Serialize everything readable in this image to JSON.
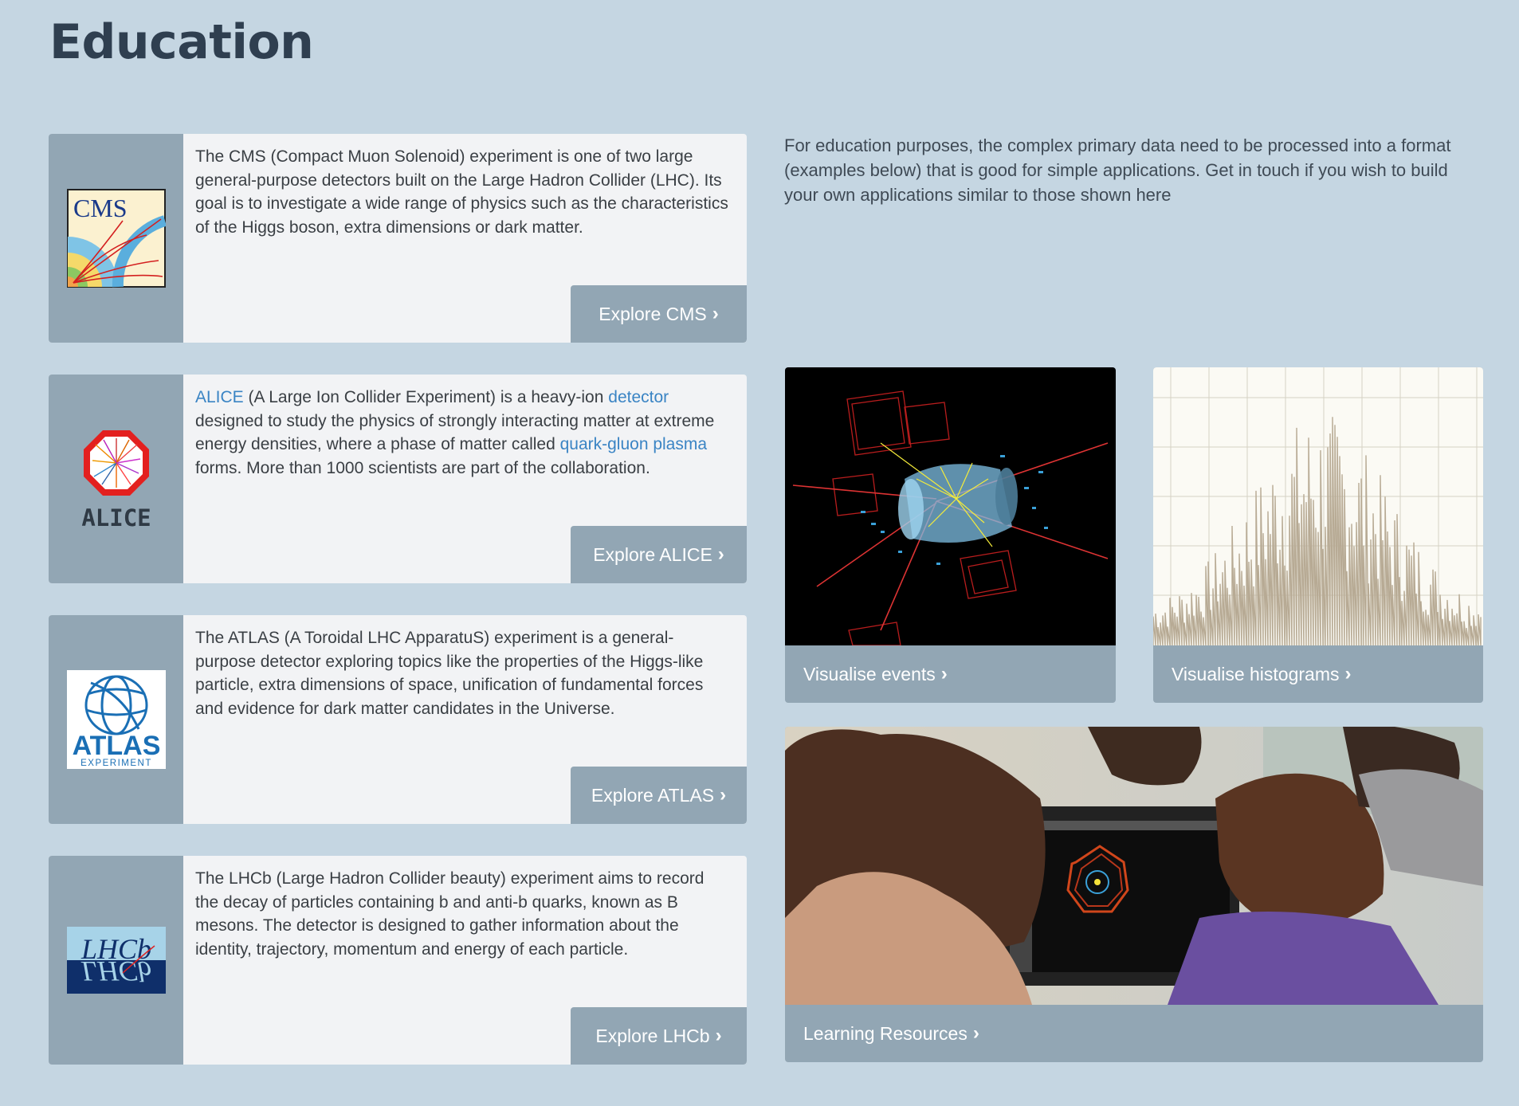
{
  "page": {
    "title": "Education"
  },
  "intro": "For education purposes, the complex primary data need to be processed into a format (examples below) that is good for simple applications. Get in touch if you wish to build your own applications similar to those shown here",
  "experiments": [
    {
      "id": "cms",
      "logo_text": "CMS",
      "description": "The CMS (Compact Muon Solenoid) experiment is one of two large general-purpose detectors built on the Large Hadron Collider (LHC). Its goal is to investigate a wide range of physics such as the characteristics of the Higgs boson, extra dimensions or dark matter.",
      "button": "Explore CMS"
    },
    {
      "id": "alice",
      "logo_text": "ALICE",
      "desc_parts": {
        "link1": "ALICE",
        "text1": " (A Large Ion Collider Experiment) is a heavy-ion ",
        "link2": "detector",
        "text2": " designed to study the physics of strongly interacting matter at extreme energy densities, where a phase of matter called ",
        "link3": "quark-gluon plasma",
        "text3": " forms. More than 1000 scientists are part of the collaboration."
      },
      "button": "Explore ALICE"
    },
    {
      "id": "atlas",
      "logo_text": "ATLAS",
      "logo_subtext": "EXPERIMENT",
      "description": "The ATLAS (A Toroidal LHC ApparatuS) experiment is a general-purpose detector exploring topics like the properties of the Higgs-like particle, extra dimensions of space, unification of fundamental forces and evidence for dark matter candidates in the Universe.",
      "button": "Explore ATLAS"
    },
    {
      "id": "lhcb",
      "logo_text": "LHCb",
      "description": "The LHCb (Large Hadron Collider beauty) experiment aims to record the decay of particles containing b and anti-b quarks, known as B mesons. The detector is designed to gather information about the identity, trajectory, momentum and energy of each particle.",
      "button": "Explore LHCb"
    }
  ],
  "tiles": {
    "events": "Visualise events",
    "histograms": "Visualise histograms",
    "learning": "Learning Resources"
  },
  "colors": {
    "background": "#c5d6e2",
    "accent": "#92a6b4",
    "card": "#f2f3f5",
    "link": "#3a84c4",
    "title": "#2f3f50"
  },
  "icons": {
    "chevron": "chevron-right-icon"
  }
}
